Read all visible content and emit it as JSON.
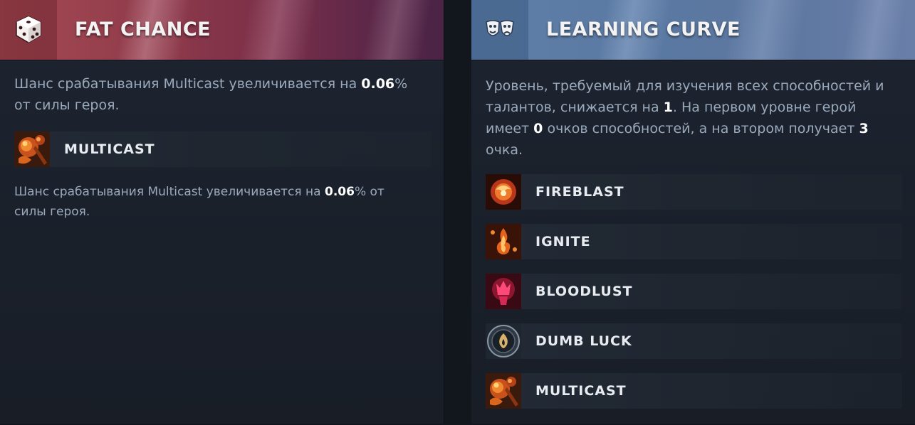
{
  "left_panel": {
    "title": "FAT CHANCE",
    "icon": "dice-icon",
    "description": {
      "part1": "Шанс срабатывания Multicast увеличивается на ",
      "value": "0.06",
      "part2": "%",
      "line2": "от силы героя."
    },
    "ability": {
      "name": "MULTICAST",
      "icon": "multicast-icon"
    },
    "ability_description": {
      "part1": "Шанс срабатывания Multicast увеличивается на ",
      "value": "0.06",
      "part2": "% от",
      "line2": "силы героя."
    }
  },
  "right_panel": {
    "title": "LEARNING CURVE",
    "icon": "masks-icon",
    "description": {
      "l1": "Уровень, требуемый для изучения всех способностей и",
      "l2a": "талантов, снижается на ",
      "v1": "1",
      "l2b": ". На первом уровне герой",
      "l3a": "имеет ",
      "v2": "0",
      "l3b": " очков способностей, а на втором получает ",
      "v3": "3",
      "l4": "очка."
    },
    "abilities": [
      {
        "name": "FIREBLAST",
        "icon": "fireblast-icon"
      },
      {
        "name": "IGNITE",
        "icon": "ignite-icon"
      },
      {
        "name": "BLOODLUST",
        "icon": "bloodlust-icon"
      },
      {
        "name": "DUMB LUCK",
        "icon": "dumb-luck-icon"
      },
      {
        "name": "MULTICAST",
        "icon": "multicast-icon"
      }
    ]
  },
  "colors": {
    "left_header": "#8f3b4b",
    "right_header": "#5a79a2",
    "panel_bg": "#1d2430",
    "text_muted": "#9aa9bb",
    "text_bright": "#ffffff"
  }
}
